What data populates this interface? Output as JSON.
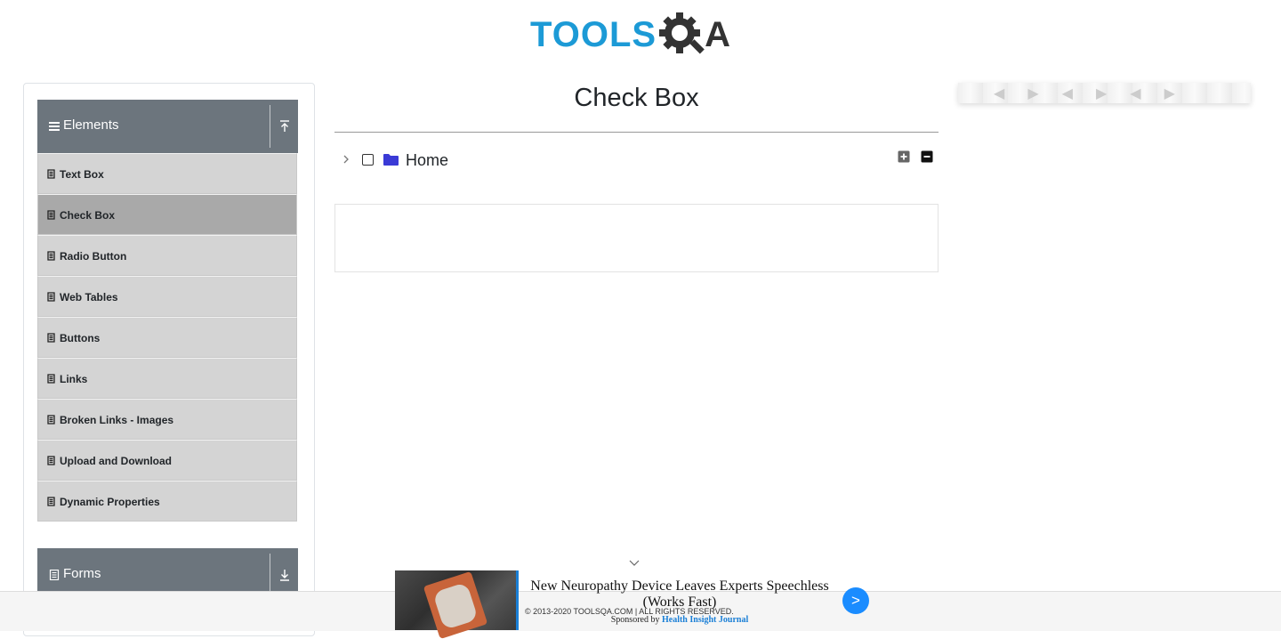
{
  "header": {
    "logo_text": "TOOLS",
    "logo_suffix": "A",
    "logo_alt": "TOOLSQA"
  },
  "sidebar": {
    "groups": [
      {
        "label": "Elements",
        "icon": "menu-icon",
        "toggle_icon": "collapse-up-icon"
      },
      {
        "label": "Forms",
        "icon": "document-icon",
        "toggle_icon": "expand-down-icon"
      }
    ],
    "items": [
      {
        "label": "Text Box"
      },
      {
        "label": "Check Box",
        "active": true
      },
      {
        "label": "Radio Button"
      },
      {
        "label": "Web Tables"
      },
      {
        "label": "Buttons"
      },
      {
        "label": "Links"
      },
      {
        "label": "Broken Links - Images"
      },
      {
        "label": "Upload and Download"
      },
      {
        "label": "Dynamic Properties"
      }
    ]
  },
  "main": {
    "title": "Check Box",
    "tree": {
      "root_label": "Home",
      "checked": false,
      "expanded": false
    }
  },
  "footer": {
    "copyright": "© 2013-2020 TOOLSQA.COM | ALL RIGHTS RESERVED."
  },
  "ad": {
    "headline": "New Neuropathy Device Leaves Experts Speechless (Works Fast)",
    "sponsor_prefix": "Sponsored by",
    "sponsor_name": "Health Insight Journal",
    "go_label": ">"
  },
  "colors": {
    "brand_blue": "#1c9ad6",
    "sidebar_group": "#6c757d",
    "menu_item": "#d4d4d4",
    "menu_item_active": "#a9a9a9",
    "folder": "#3a3ad6",
    "ad_button": "#1a8cff"
  }
}
